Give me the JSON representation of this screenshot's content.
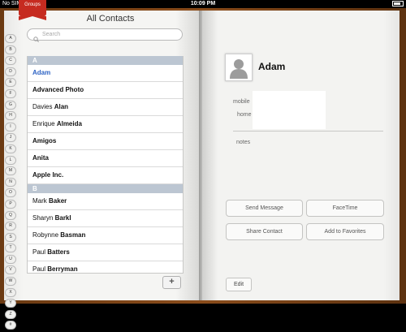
{
  "status_bar": {
    "carrier": "No SIM",
    "time": "10:09 PM",
    "battery": "85%"
  },
  "left_page": {
    "groups_label": "Groups",
    "title": "All Contacts",
    "search_placeholder": "Search",
    "index_letters": [
      "A",
      "B",
      "C",
      "D",
      "E",
      "F",
      "G",
      "H",
      "I",
      "J",
      "K",
      "L",
      "M",
      "N",
      "O",
      "P",
      "Q",
      "R",
      "S",
      "T",
      "U",
      "V",
      "W",
      "X",
      "Y",
      "Z",
      "#"
    ],
    "sections": [
      {
        "header": "A",
        "rows": [
          {
            "first": "Adam",
            "last": "",
            "selected": true
          },
          {
            "first": "",
            "last": "Advanced Photo"
          },
          {
            "first": "Davies",
            "last": "Alan"
          },
          {
            "first": "Enrique",
            "last": "Almeida"
          },
          {
            "first": "",
            "last": "Amigos"
          },
          {
            "first": "",
            "last": "Anita"
          },
          {
            "first": "",
            "last": "Apple Inc."
          }
        ]
      },
      {
        "header": "B",
        "rows": [
          {
            "first": "Mark",
            "last": "Baker"
          },
          {
            "first": "Sharyn",
            "last": "Barkl"
          },
          {
            "first": "Robynne",
            "last": "Basman"
          },
          {
            "first": "Paul",
            "last": "Batters"
          },
          {
            "first": "Paul",
            "last": "Berryman"
          }
        ]
      }
    ],
    "add_label": "+"
  },
  "right_page": {
    "contact_name": "Adam",
    "fields": {
      "mobile": "mobile",
      "home": "home",
      "notes": "notes"
    },
    "buttons": {
      "send_message": "Send Message",
      "facetime": "FaceTime",
      "share_contact": "Share Contact",
      "add_favorites": "Add to Favorites"
    },
    "edit_label": "Edit"
  }
}
